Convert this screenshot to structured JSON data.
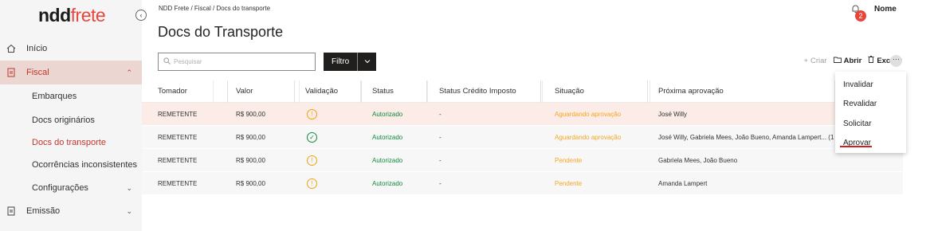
{
  "brand": {
    "part1": "ndd",
    "part2": "frete"
  },
  "collapse_icon": "chevron-left-icon",
  "sidebar": {
    "items": [
      {
        "label": "Início",
        "icon": "home-icon"
      },
      {
        "label": "Fiscal",
        "icon": "document-icon",
        "chevron": "⌃"
      },
      {
        "label": "Embarques"
      },
      {
        "label": "Docs originários"
      },
      {
        "label": "Docs do transporte"
      },
      {
        "label": "Ocorrências inconsistentes"
      },
      {
        "label": "Configurações",
        "chevron": "⌄"
      },
      {
        "label": "Emissão",
        "icon": "document-icon",
        "chevron": "⌄"
      }
    ]
  },
  "header": {
    "breadcrumb": "NDD Frete / Fiscal / Docs do transporte",
    "title": "Docs do Transporte",
    "notifications": "2",
    "user": "Nome"
  },
  "search": {
    "placeholder": "Pesquisar"
  },
  "filter": {
    "label": "Filtro"
  },
  "toolbar": {
    "create": "Criar",
    "open": "Abrir",
    "delete": "Excluir",
    "more": "···"
  },
  "table": {
    "columns": [
      "Tomador",
      "Valor",
      "Validação",
      "Status",
      "Status Crédito Imposto",
      "Situação",
      "Próxima aprovação"
    ],
    "rows": [
      {
        "tomador": "REMETENTE",
        "valor": "R$ 900,00",
        "validacao": "warning",
        "status": "Autorizado",
        "credito": "-",
        "situacao": "Aguardando aprovação",
        "proxima": "José Willy"
      },
      {
        "tomador": "REMETENTE",
        "valor": "R$ 900,00",
        "validacao": "ok",
        "status": "Autorizado",
        "credito": "-",
        "situacao": "Aguardando aprovação",
        "proxima": "José Willy, Gabriela Mees, João Bueno, Amanda Lampert... (1"
      },
      {
        "tomador": "REMETENTE",
        "valor": "R$ 900,00",
        "validacao": "warning",
        "status": "Autorizado",
        "credito": "-",
        "situacao": "Pendente",
        "proxima": "Gabriela Mees, João Bueno"
      },
      {
        "tomador": "REMETENTE",
        "valor": "R$ 900,00",
        "validacao": "warning",
        "status": "Autorizado",
        "credito": "-",
        "situacao": "Pendente",
        "proxima": "Amanda Lampert"
      }
    ]
  },
  "menu": {
    "items": [
      "Invalidar",
      "Revalidar",
      "Solicitar",
      "Aprovar"
    ]
  },
  "colors": {
    "accent": "#e8453c",
    "status_ok": "#10893e",
    "situacao": "#f5a623"
  }
}
